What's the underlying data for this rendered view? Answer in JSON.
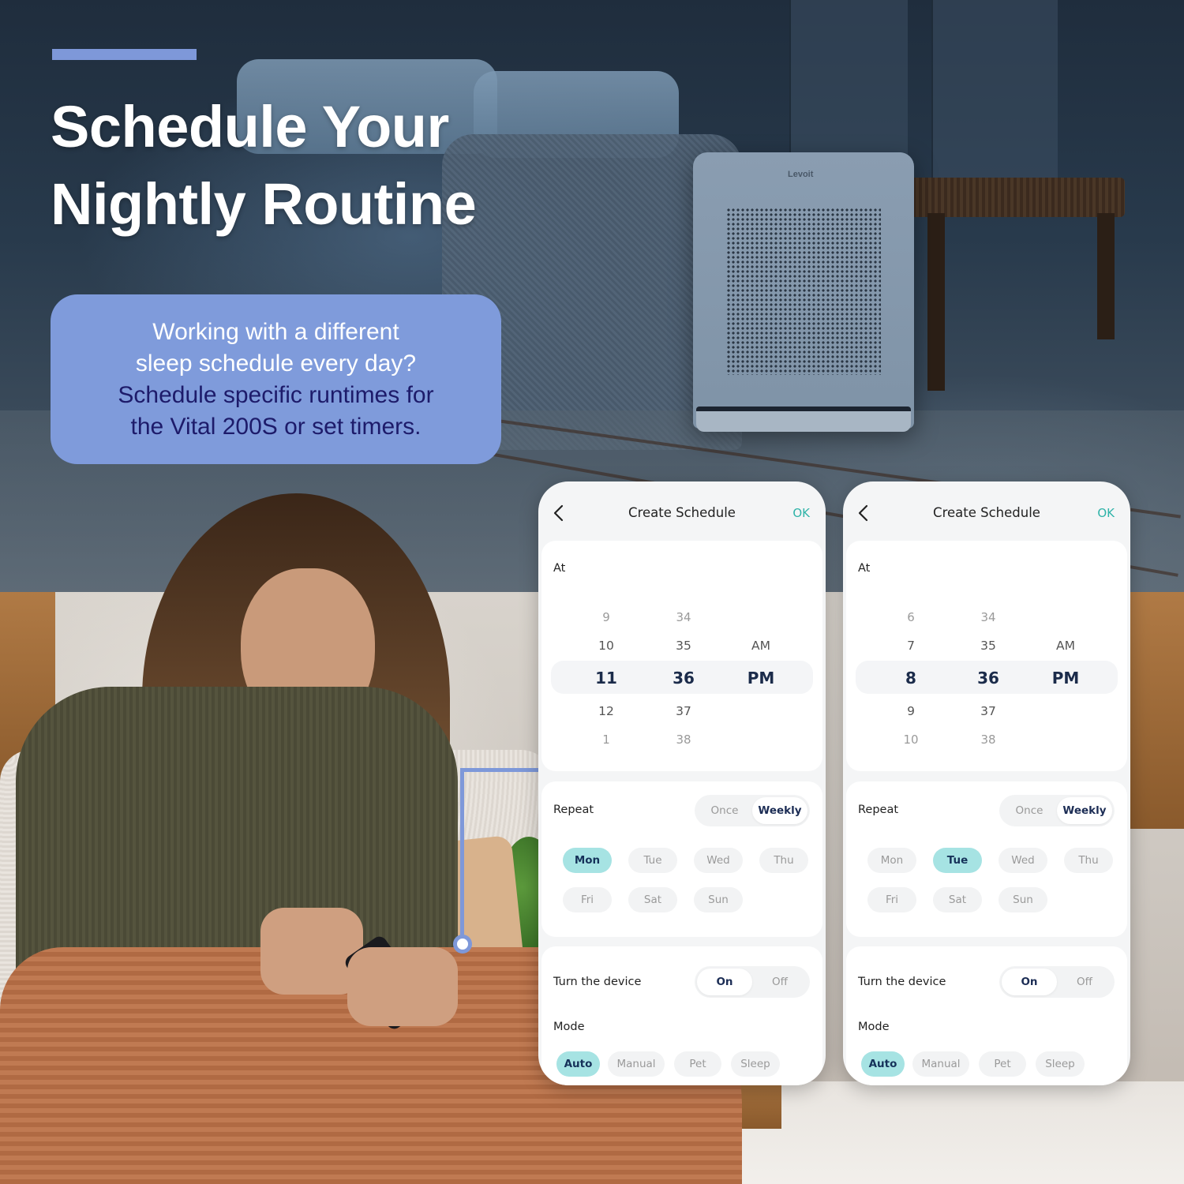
{
  "headline": {
    "line1": "Schedule Your",
    "line2": "Nightly Routine"
  },
  "callout": {
    "light_line1": "Working with a different",
    "light_line2": "sleep schedule every day?",
    "dark_line1": "Schedule specific runtimes for",
    "dark_line2": "the Vital 200S or set timers."
  },
  "device": {
    "brand_logo": "Levoit"
  },
  "colors": {
    "accent": "#7e98d9",
    "callout_bg": "#7f9bdb",
    "callout_dark_text": "#1d1b6a",
    "ok_teal": "#2fb3a8",
    "chip_selected": "#a6e3e3"
  },
  "panels": [
    {
      "title": "Create Schedule",
      "back_icon": "chevron-left-icon",
      "ok_label": "OK",
      "at_label": "At",
      "picker": {
        "hours": [
          "9",
          "10",
          "11",
          "12",
          "1"
        ],
        "minutes": [
          "34",
          "35",
          "36",
          "37",
          "38"
        ],
        "ampm": [
          "",
          "AM",
          "PM",
          "",
          ""
        ],
        "selected": {
          "hour": "11",
          "minute": "36",
          "ampm": "PM"
        }
      },
      "repeat_label": "Repeat",
      "repeat_options": [
        "Once",
        "Weekly"
      ],
      "repeat_selected": "Weekly",
      "days": [
        "Mon",
        "Tue",
        "Wed",
        "Thu",
        "Fri",
        "Sat",
        "Sun"
      ],
      "days_selected": [
        "Mon"
      ],
      "device_label": "Turn the device",
      "device_options": [
        "On",
        "Off"
      ],
      "device_selected": "On",
      "mode_label": "Mode",
      "modes": [
        "Auto",
        "Manual",
        "Pet",
        "Sleep"
      ],
      "mode_selected": "Auto"
    },
    {
      "title": "Create Schedule",
      "back_icon": "chevron-left-icon",
      "ok_label": "OK",
      "at_label": "At",
      "picker": {
        "hours": [
          "6",
          "7",
          "8",
          "9",
          "10"
        ],
        "minutes": [
          "34",
          "35",
          "36",
          "37",
          "38"
        ],
        "ampm": [
          "",
          "AM",
          "PM",
          "",
          ""
        ],
        "selected": {
          "hour": "8",
          "minute": "36",
          "ampm": "PM"
        }
      },
      "repeat_label": "Repeat",
      "repeat_options": [
        "Once",
        "Weekly"
      ],
      "repeat_selected": "Weekly",
      "days": [
        "Mon",
        "Tue",
        "Wed",
        "Thu",
        "Fri",
        "Sat",
        "Sun"
      ],
      "days_selected": [
        "Tue"
      ],
      "device_label": "Turn the device",
      "device_options": [
        "On",
        "Off"
      ],
      "device_selected": "On",
      "mode_label": "Mode",
      "modes": [
        "Auto",
        "Manual",
        "Pet",
        "Sleep"
      ],
      "mode_selected": "Auto"
    }
  ]
}
